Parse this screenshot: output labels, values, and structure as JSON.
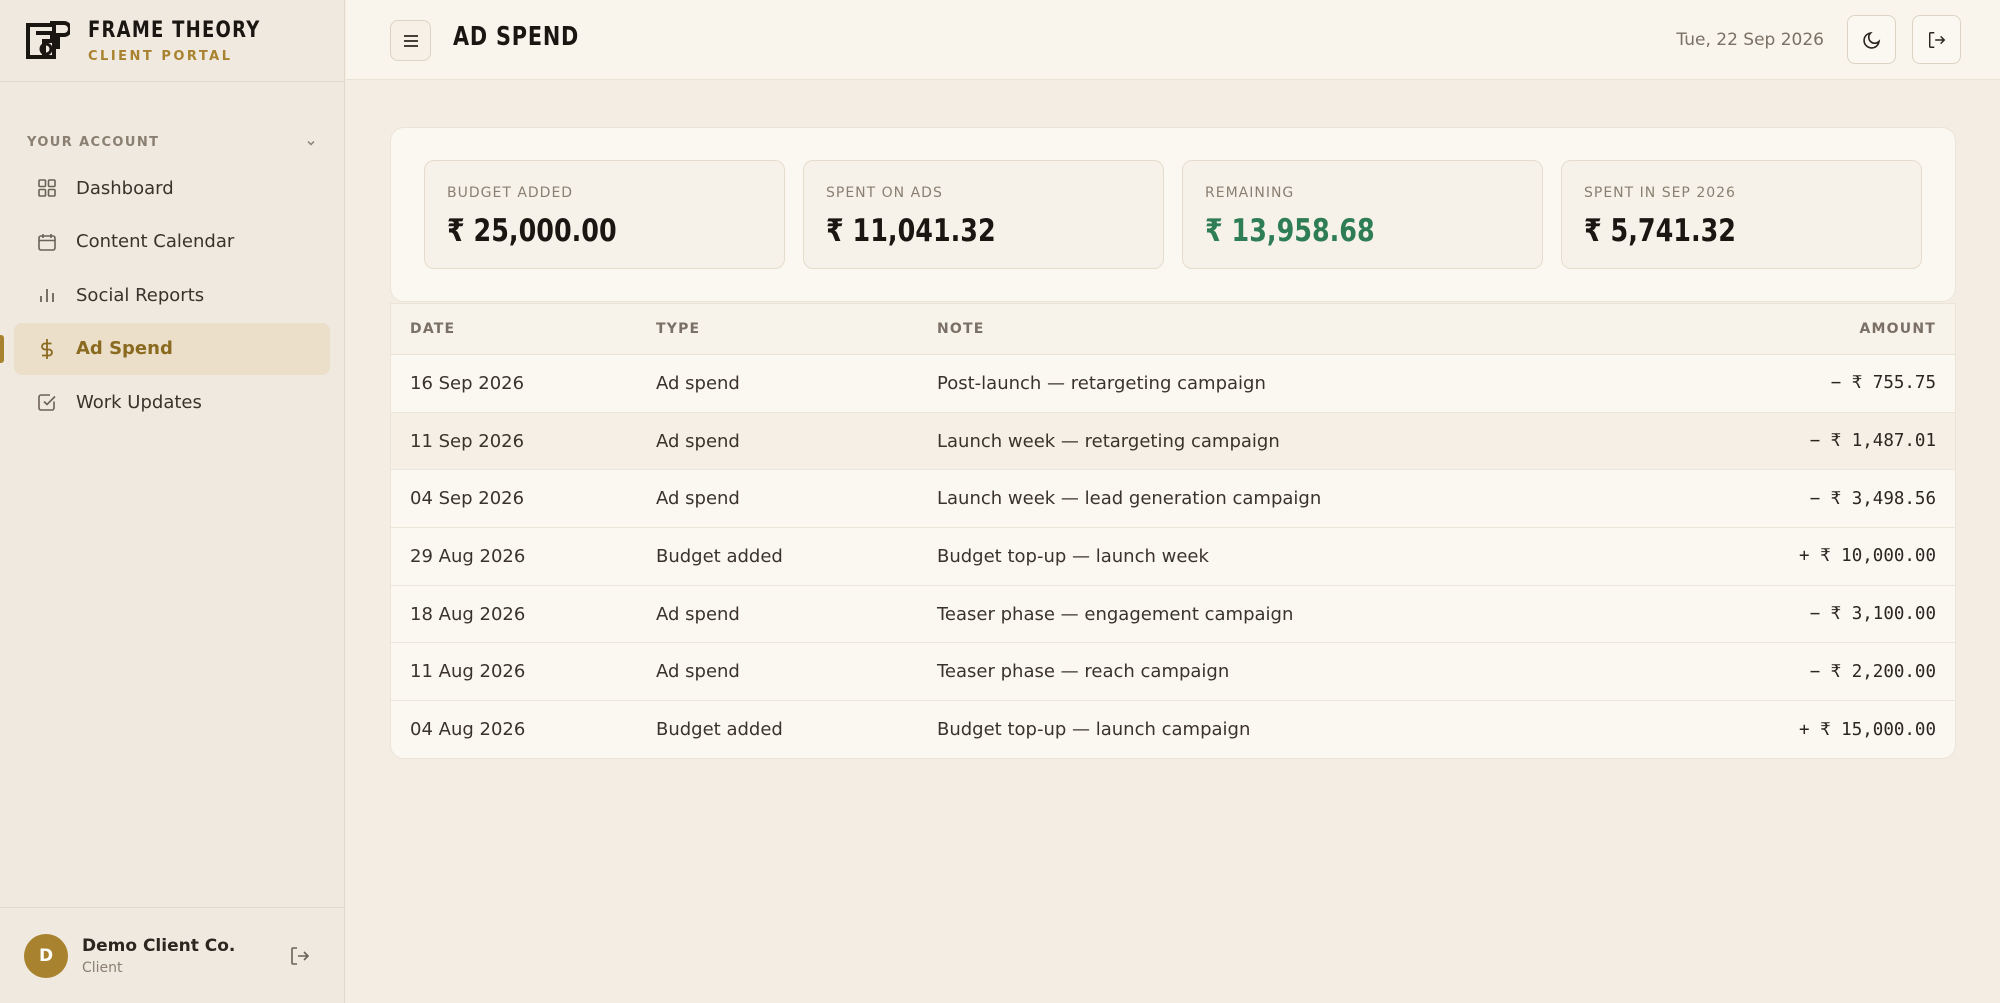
{
  "brand": {
    "name": "FRAME THEORY",
    "subtitle": "CLIENT PORTAL"
  },
  "sidebar": {
    "section_title": "YOUR ACCOUNT",
    "items": [
      {
        "label": "Dashboard",
        "icon": "grid-icon"
      },
      {
        "label": "Content Calendar",
        "icon": "calendar-icon"
      },
      {
        "label": "Social Reports",
        "icon": "bar-chart-icon"
      },
      {
        "label": "Ad Spend",
        "icon": "dollar-icon",
        "active": true
      },
      {
        "label": "Work Updates",
        "icon": "check-square-icon"
      }
    ],
    "user": {
      "initial": "D",
      "name": "Demo Client Co.",
      "role": "Client"
    }
  },
  "header": {
    "title": "AD SPEND",
    "date": "Tue, 22 Sep 2026"
  },
  "stats": [
    {
      "label": "BUDGET ADDED",
      "value": "₹ 25,000.00"
    },
    {
      "label": "SPENT ON ADS",
      "value": "₹ 11,041.32"
    },
    {
      "label": "REMAINING",
      "value": "₹ 13,958.68"
    },
    {
      "label": "SPENT IN SEP 2026",
      "value": "₹ 5,741.32"
    }
  ],
  "table": {
    "headers": {
      "date": "DATE",
      "type": "TYPE",
      "note": "NOTE",
      "amount": "AMOUNT"
    },
    "rows": [
      {
        "date": "16 Sep 2026",
        "type": "Ad spend",
        "note": "Post-launch — retargeting campaign",
        "amount": "− ₹ 755.75"
      },
      {
        "date": "11 Sep 2026",
        "type": "Ad spend",
        "note": "Launch week — retargeting campaign",
        "amount": "− ₹ 1,487.01"
      },
      {
        "date": "04 Sep 2026",
        "type": "Ad spend",
        "note": "Launch week — lead generation campaign",
        "amount": "− ₹ 3,498.56"
      },
      {
        "date": "29 Aug 2026",
        "type": "Budget added",
        "note": "Budget top-up — launch week",
        "amount": "+ ₹ 10,000.00"
      },
      {
        "date": "18 Aug 2026",
        "type": "Ad spend",
        "note": "Teaser phase — engagement campaign",
        "amount": "− ₹ 3,100.00"
      },
      {
        "date": "11 Aug 2026",
        "type": "Ad spend",
        "note": "Teaser phase — reach campaign",
        "amount": "− ₹ 2,200.00"
      },
      {
        "date": "04 Aug 2026",
        "type": "Budget added",
        "note": "Budget top-up — launch campaign",
        "amount": "+ ₹ 15,000.00"
      }
    ]
  },
  "colors": {
    "accent": "#a8822e",
    "positive": "#2e7d55"
  }
}
